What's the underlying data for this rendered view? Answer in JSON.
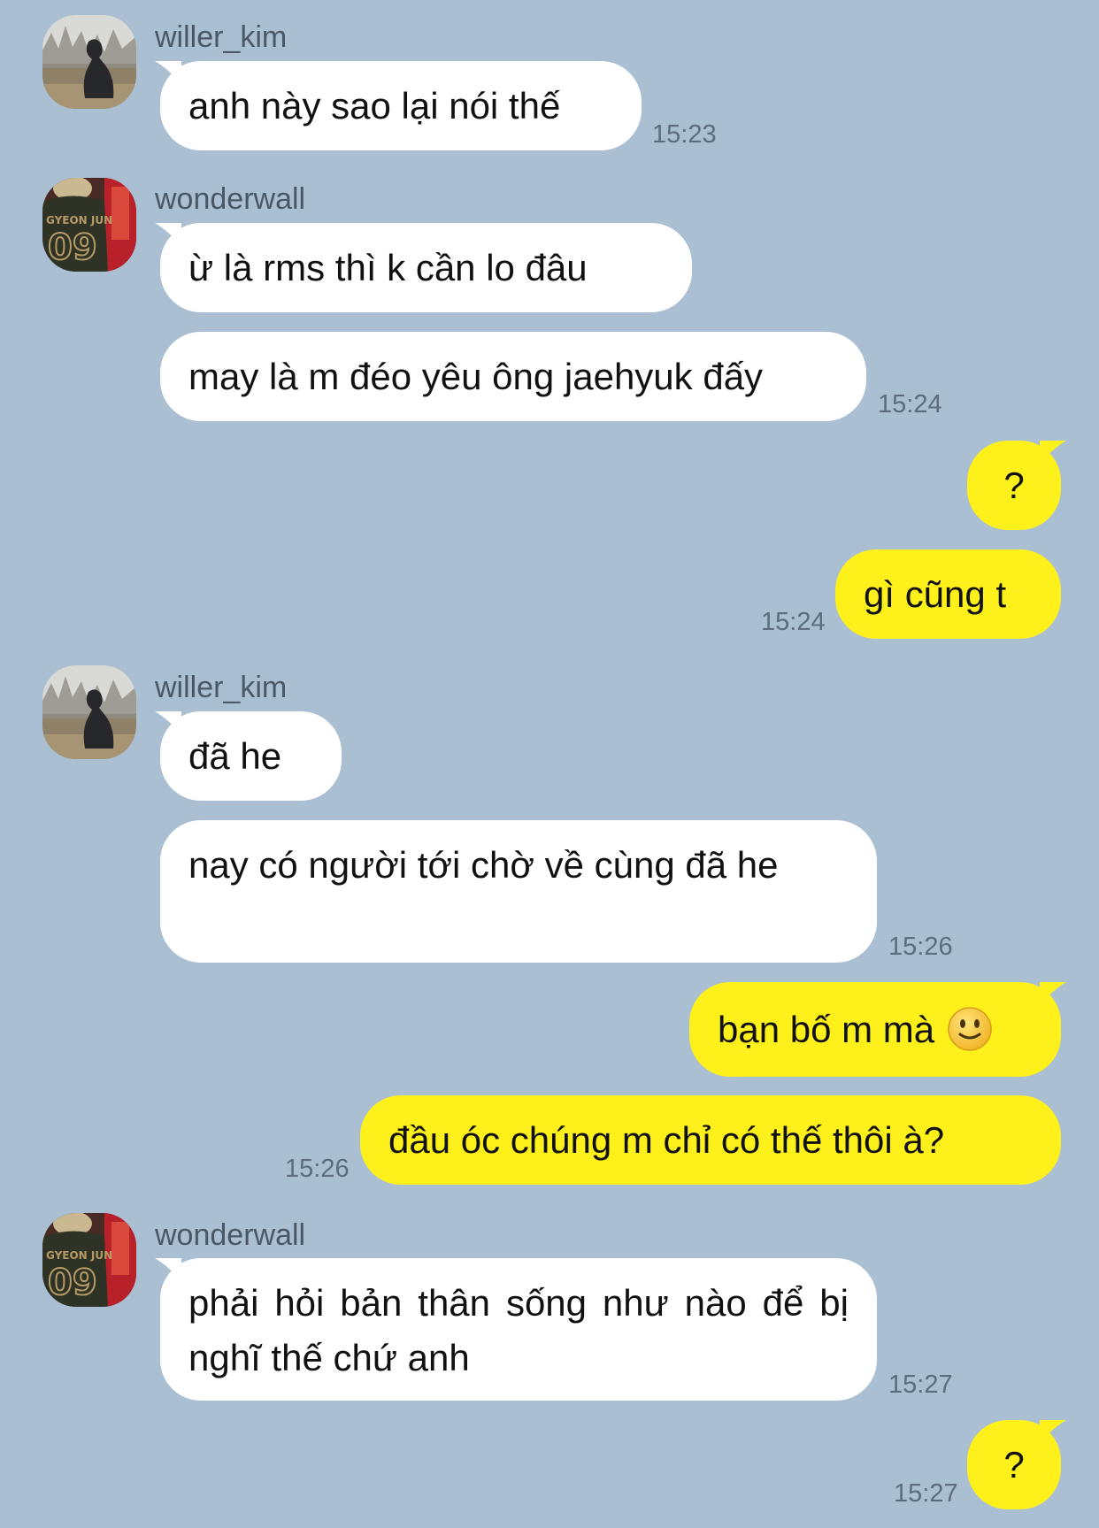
{
  "colors": {
    "background": "#aabfd2",
    "incoming_bubble": "#ffffff",
    "outgoing_bubble": "#fef01b",
    "timestamp": "#5d6d7d"
  },
  "messages": [
    {
      "sender": "willer_kim",
      "text": "anh này sao lại nói thế",
      "time": "15:23"
    },
    {
      "sender": "wonderwall",
      "text": "ừ là rms thì k cần lo đâu"
    },
    {
      "text": "may là m đéo yêu ông jaehyuk đấy",
      "time": "15:24"
    },
    {
      "text": "?"
    },
    {
      "text": "gì cũng t",
      "time": "15:24"
    },
    {
      "sender": "willer_kim",
      "text": "đã he"
    },
    {
      "text": "nay có người tới chờ về cùng đã he",
      "time": "15:26"
    },
    {
      "text": "bạn bố m mà",
      "emoji": "slightly-smiling-face-icon"
    },
    {
      "text": "đầu óc chúng m chỉ có thế thôi à?",
      "time": "15:26"
    },
    {
      "sender": "wonderwall",
      "text": "phải hỏi bản thân sống như nào để bị nghĩ thế chứ anh",
      "time": "15:27"
    },
    {
      "text": "?",
      "time": "15:27"
    }
  ]
}
